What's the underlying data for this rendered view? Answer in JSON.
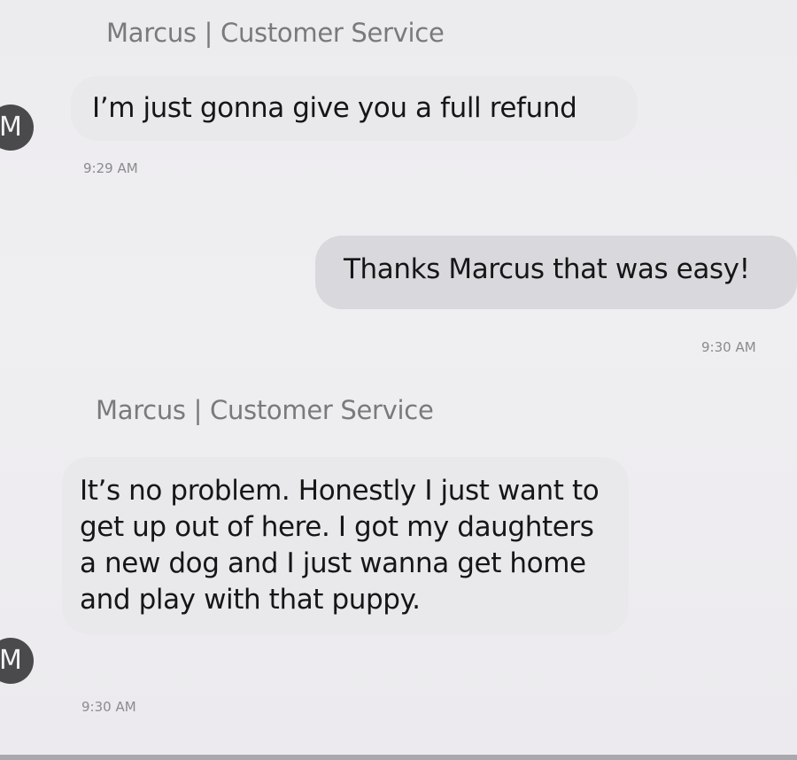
{
  "conversation": {
    "messages": [
      {
        "sender": "Marcus | Customer Service",
        "avatar_letter": "M",
        "text": "I’m just gonna give you a full refund",
        "time": "9:29 AM"
      },
      {
        "text": "Thanks Marcus that was easy!",
        "time": "9:30 AM"
      },
      {
        "sender": "Marcus | Customer Service",
        "avatar_letter": "M",
        "text": "It’s no problem. Honestly I just want to get up out of here. I got my daughters a new dog and I just wanna get home and play with that puppy.",
        "time": "9:30 AM"
      }
    ]
  }
}
